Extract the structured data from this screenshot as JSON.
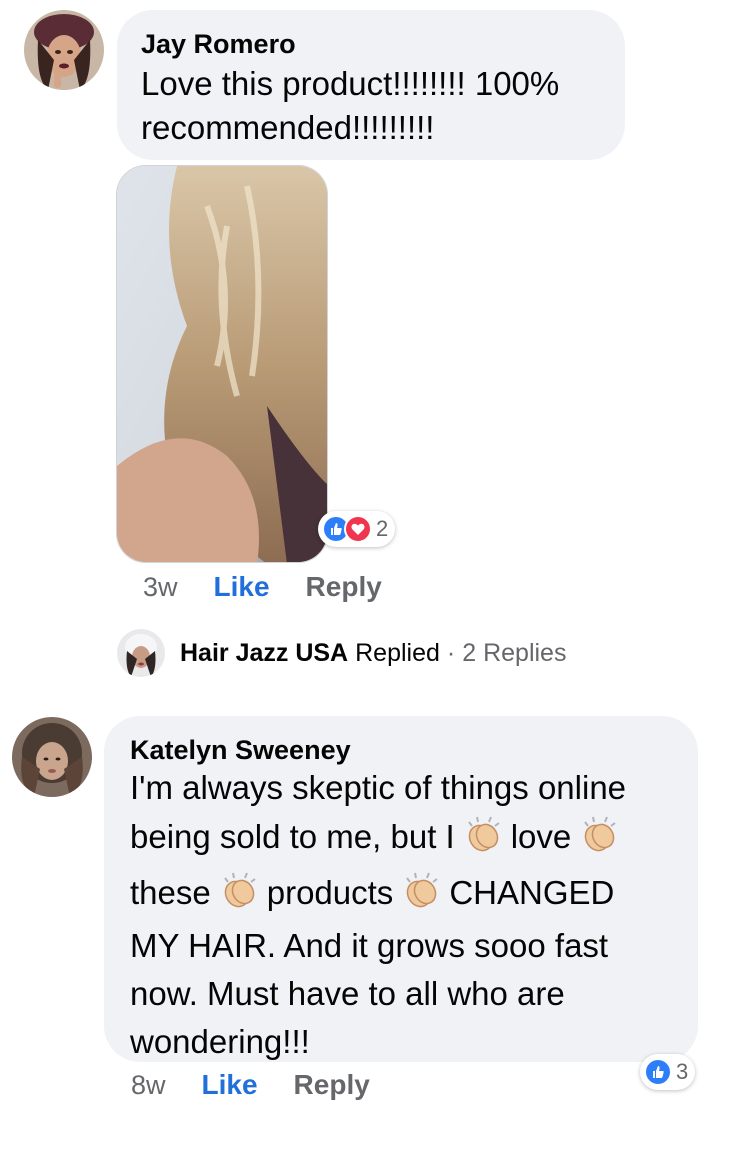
{
  "comments": [
    {
      "author": "Jay Romero",
      "text_lines": [
        "Love this product!!!!!!!! 100%",
        "recommended!!!!!!!!!"
      ],
      "reaction_count": "2",
      "reaction_icons": [
        "like-icon",
        "love-icon"
      ],
      "time": "3w",
      "like_label": "Like",
      "reply_label": "Reply"
    },
    {
      "author": "Katelyn Sweeney",
      "text": {
        "l1": "I'm always skeptic of things online",
        "l2a": "being sold to me, but I",
        "l2b": "love",
        "l3a": "these",
        "l3b": "products",
        "l3c": "CHANGED",
        "l4": "MY HAIR. And it grows sooo fast",
        "l5": "now. Must have to all who are",
        "l6": "wondering!!!"
      },
      "reaction_count": "3",
      "reaction_icons": [
        "like-icon"
      ],
      "time": "8w",
      "like_label": "Like",
      "reply_label": "Reply"
    }
  ],
  "replied_row": {
    "page_name": "Hair Jazz USA",
    "replied_label": "Replied",
    "separator": "·",
    "replies_count": "2 Replies"
  },
  "colors": {
    "bubble": "#f0f2f5",
    "like_blue": "#216fdb",
    "muted": "#65676b",
    "love_red": "#f0364e"
  }
}
